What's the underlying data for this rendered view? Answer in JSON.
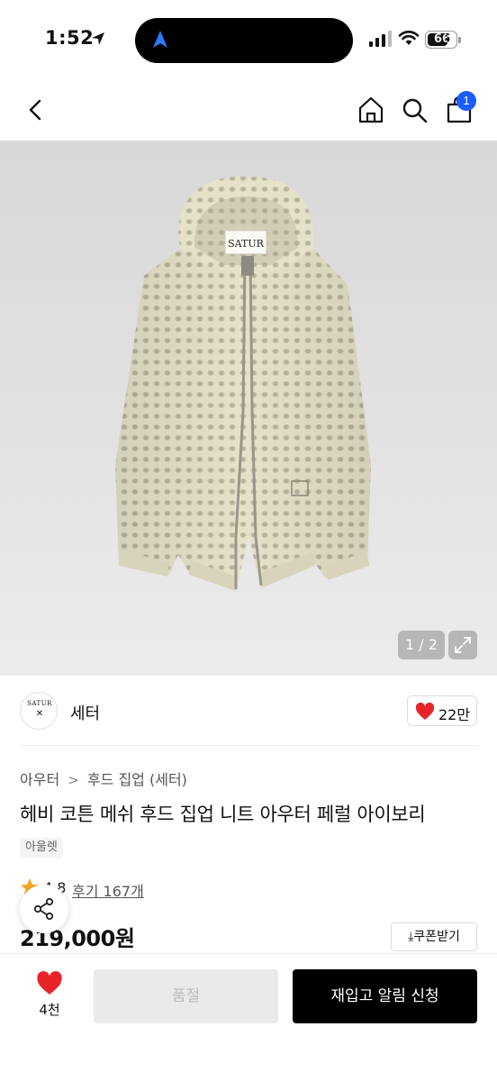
{
  "status_bar": {
    "time": "1:52",
    "battery": "66"
  },
  "nav": {
    "cart_badge": "1"
  },
  "hero": {
    "pager": "1 / 2",
    "garment_label": "SATUR"
  },
  "brand": {
    "logo_text": "SATUR",
    "name": "세터",
    "likes": "22만"
  },
  "product": {
    "breadcrumb": [
      "아우터",
      "후드 집업 (세터)"
    ],
    "title": "헤비 코튼 메쉬 후드 집업 니트 아우터 페럴 아이보리",
    "tag": "아울렛",
    "rating": "4.8",
    "reviews": "후기 167개",
    "price": "219,000원",
    "coupon_label": "쿠폰받기"
  },
  "bottom_bar": {
    "wish_count": "4천",
    "soldout_label": "품절",
    "restock_label": "재입고 알림 신청"
  },
  "colors": {
    "accent_blue": "#1a5cff",
    "heart_red": "#e8232a",
    "star_orange": "#f5a623"
  }
}
